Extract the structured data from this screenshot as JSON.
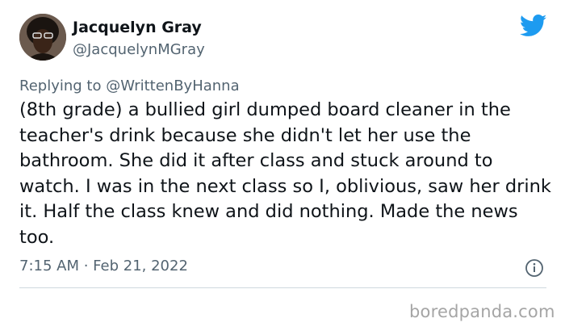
{
  "author": {
    "name": "Jacquelyn Gray",
    "handle": "@JacquelynMGray"
  },
  "reply": {
    "prefix": "Replying to",
    "mention": "@WrittenByHanna"
  },
  "tweet": {
    "text": "(8th grade) a bullied girl dumped board cleaner in the teacher's drink because she didn't let her use the bathroom. She did it after class and stuck around to watch. I was in the next class so I, oblivious, saw her drink it. Half the class knew and did nothing. Made the news too."
  },
  "meta": {
    "timestamp": "7:15 AM · Feb 21, 2022"
  },
  "watermark": {
    "text": "boredpanda.com"
  },
  "icons": {
    "brand": "twitter-bird-icon",
    "info": "info-icon"
  },
  "colors": {
    "twitter_blue": "#1d9bf0",
    "secondary_text": "#536471",
    "divider": "#cfd9de"
  }
}
